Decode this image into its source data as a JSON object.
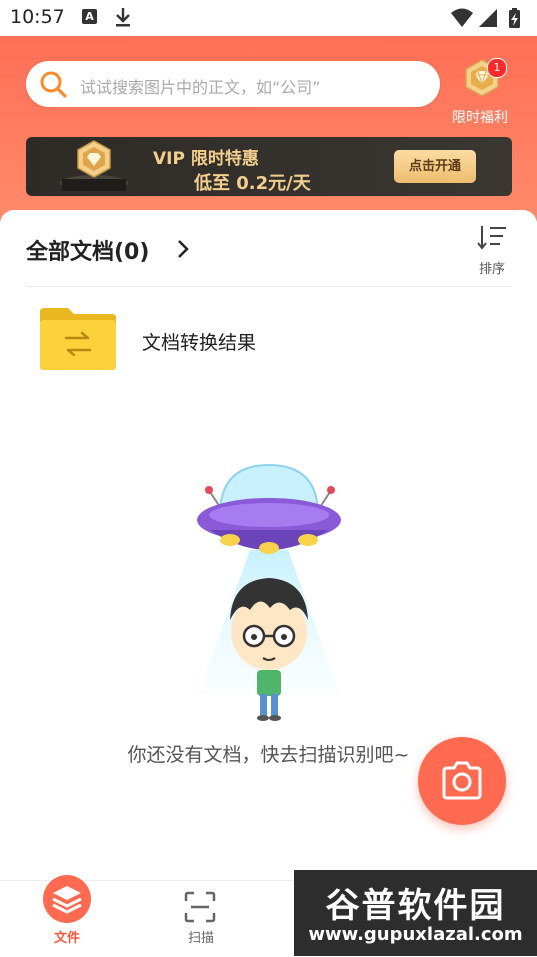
{
  "status_bar": {
    "time": "10:57",
    "notification_a": "A",
    "icons": [
      "font-app-icon",
      "download-icon",
      "wifi-icon",
      "signal-icon",
      "battery-charging-icon"
    ]
  },
  "header": {
    "search": {
      "placeholder": "试试搜索图片中的正文，如“公司”",
      "icon": "search-icon"
    },
    "gift": {
      "label": "限时福利",
      "badge_count": "1",
      "icon": "diamond-gift-icon"
    },
    "vip_banner": {
      "line1": "VIP 限时特惠",
      "line2": "低至 0.2元/天",
      "button_label": "点击开通",
      "icon": "vip-diamond-icon"
    }
  },
  "documents": {
    "title": "全部文档(0)",
    "sort_label": "排序",
    "folders": [
      {
        "name": "文档转换结果",
        "icon": "folder-convert-icon"
      }
    ],
    "empty_text": "你还没有文档，快去扫描识别吧~"
  },
  "bottom_nav": {
    "items": [
      {
        "label": "文件",
        "icon": "layers-icon",
        "active": true
      },
      {
        "label": "扫描",
        "icon": "scan-icon",
        "active": false
      }
    ]
  },
  "watermark": {
    "title": "谷普软件园",
    "url": "www.gupuxlazal.com"
  },
  "colors": {
    "accent": "#ff6a50",
    "vip_gold": "#f3cf8e",
    "vip_bg": "#2e2b27"
  }
}
